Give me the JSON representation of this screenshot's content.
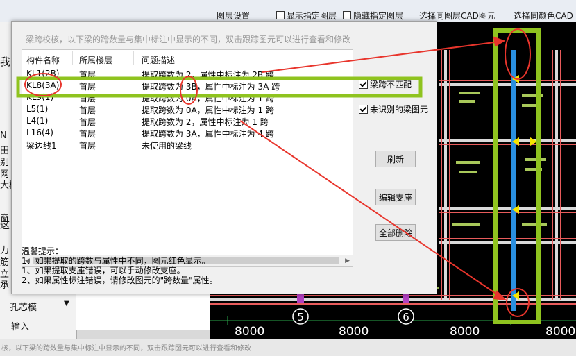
{
  "toolbar": {
    "items": [
      "图层设置",
      "显示指定图层",
      "隐藏指定图层",
      "选择同图层CAD图元",
      "选择同颜色CAD"
    ]
  },
  "left_panel": {
    "texts": [
      "我",
      "N",
      "田",
      "别",
      "网",
      "大样",
      "窗",
      "这",
      "力",
      "筋",
      "立",
      "承",
      "孔芯模",
      "输入"
    ]
  },
  "status_bar": {
    "text": "核，以下梁的跨数量与集中标注中显示的不同，双击跟踪图元可以进行查看和修改"
  },
  "dialog": {
    "title": "梁跨校核，以下梁的跨数量与集中标注中显示的不同，双击跟踪图元可以进行查看和修改",
    "columns": [
      "构件名称",
      "所属楼层",
      "问题描述"
    ],
    "rows": [
      [
        "KL1(2B)",
        "首层",
        "提取跨数为 2，属性中标注为 2B 跨"
      ],
      [
        "KL8(3A)",
        "首层",
        "提取跨数为 3B，属性中标注为 3A 跨"
      ],
      [
        "KL9(1)",
        "首层",
        "提取跨数为 0A，属性中标注为 1 跨"
      ],
      [
        "L5(1)",
        "首层",
        "提取跨数为 0A，属性中标注为 1 跨"
      ],
      [
        "L4(1)",
        "首层",
        "提取跨数为 2，属性中标注为 1 跨"
      ],
      [
        "L16(4)",
        "首层",
        "提取跨数为 3A，属性中标注为 4 跨"
      ],
      [
        "梁边线1",
        "首层",
        "未使用的梁线"
      ]
    ],
    "checkboxes": [
      "梁跨不匹配",
      "未识别的梁图元"
    ],
    "buttons": [
      "刷新",
      "编辑支座",
      "全部删除"
    ],
    "tips": [
      "温馨提示：",
      "1、如果提取的跨数与属性中不同，图元红色显示。",
      "  1、如果提取支座错误，可以手动修改支座。",
      "  2、如果属性标注错误，请修改图元的\"跨数量\"属性。"
    ]
  },
  "cad": {
    "dimensions": [
      "8000",
      "8000",
      "8000",
      "8000"
    ],
    "axis_labels": [
      "5",
      "6"
    ]
  },
  "colors": {
    "highlight": "#8fc31f",
    "annotation": "#e8352c",
    "dialog_bg": "#f0f0f0",
    "cad_bg": "#000000"
  }
}
